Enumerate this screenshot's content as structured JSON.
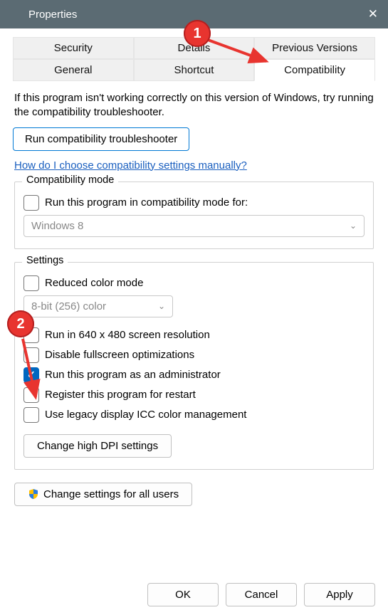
{
  "titlebar": {
    "title": "Properties"
  },
  "tabs": {
    "row1": [
      "Security",
      "Details",
      "Previous Versions"
    ],
    "row2": [
      "General",
      "Shortcut",
      "Compatibility"
    ]
  },
  "description": "If this program isn't working correctly on this version of Windows, try running the compatibility troubleshooter.",
  "troubleshoot_btn": "Run compatibility troubleshooter",
  "manual_link": "How do I choose compatibility settings manually?",
  "compat_mode": {
    "legend": "Compatibility mode",
    "checkbox_label": "Run this program in compatibility mode for:",
    "select_value": "Windows 8"
  },
  "settings": {
    "legend": "Settings",
    "reduced_color": "Reduced color mode",
    "color_select": "8-bit (256) color",
    "run_640": "Run in 640 x 480 screen resolution",
    "disable_fullscreen": "Disable fullscreen optimizations",
    "run_admin": "Run this program as an administrator",
    "register_restart": "Register this program for restart",
    "legacy_icc": "Use legacy display ICC color management",
    "high_dpi_btn": "Change high DPI settings"
  },
  "all_users_btn": "Change settings for all users",
  "buttons": {
    "ok": "OK",
    "cancel": "Cancel",
    "apply": "Apply"
  },
  "callouts": {
    "one": "1",
    "two": "2"
  }
}
